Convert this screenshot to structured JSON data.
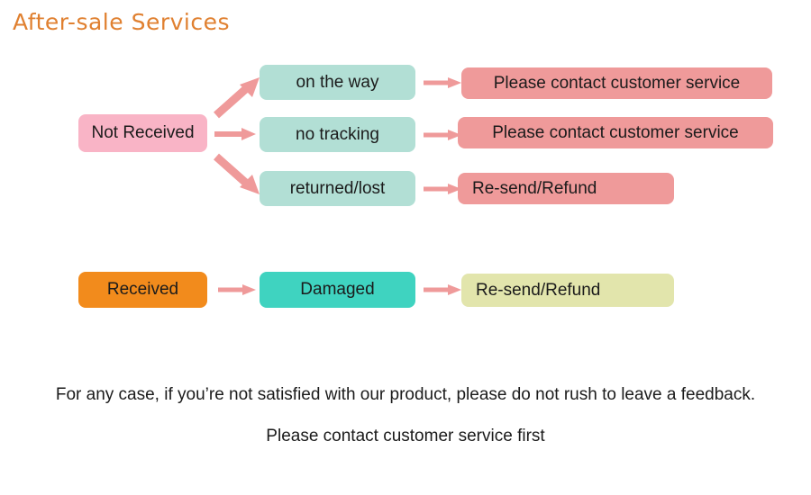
{
  "title": "After-sale Services",
  "colors": {
    "title": "#e08030",
    "pink_light": "#f9b4c6",
    "mint": "#b2dfd5",
    "salmon": "#ef9a9a",
    "orange": "#f28b1c",
    "turquoise": "#3fd3c0",
    "yellow_green": "#e2e5ac",
    "arrow": "#ef9a9a",
    "text": "#1b1b1b",
    "background": "#ffffff"
  },
  "flow": {
    "row1": {
      "source": {
        "label": "Not Received",
        "color": "#f9b4c6"
      },
      "branches": [
        {
          "stage": {
            "label": "on the way",
            "color": "#b2dfd5"
          },
          "result": {
            "label": "Please contact customer service",
            "color": "#ef9a9a"
          },
          "arrow_in": "diagonal-up-arrow",
          "arrow_out": "right-arrow"
        },
        {
          "stage": {
            "label": "no tracking",
            "color": "#b2dfd5"
          },
          "result": {
            "label": "Please contact customer service",
            "color": "#ef9a9a"
          },
          "arrow_in": "right-arrow",
          "arrow_out": "right-arrow"
        },
        {
          "stage": {
            "label": "returned/lost",
            "color": "#b2dfd5"
          },
          "result": {
            "label": "Re-send/Refund",
            "color": "#ef9a9a"
          },
          "arrow_in": "diagonal-down-arrow",
          "arrow_out": "right-arrow"
        }
      ]
    },
    "row2": {
      "source": {
        "label": "Received",
        "color": "#f28b1c"
      },
      "stage": {
        "label": "Damaged",
        "color": "#3fd3c0"
      },
      "result": {
        "label": "Re-send/Refund",
        "color": "#e2e5ac"
      },
      "arrow_1": "right-arrow",
      "arrow_2": "right-arrow"
    }
  },
  "footer": {
    "line1": "For any case, if you’re not satisfied with our product, please do not rush to leave a feedback.",
    "line2": "Please contact customer service first"
  }
}
